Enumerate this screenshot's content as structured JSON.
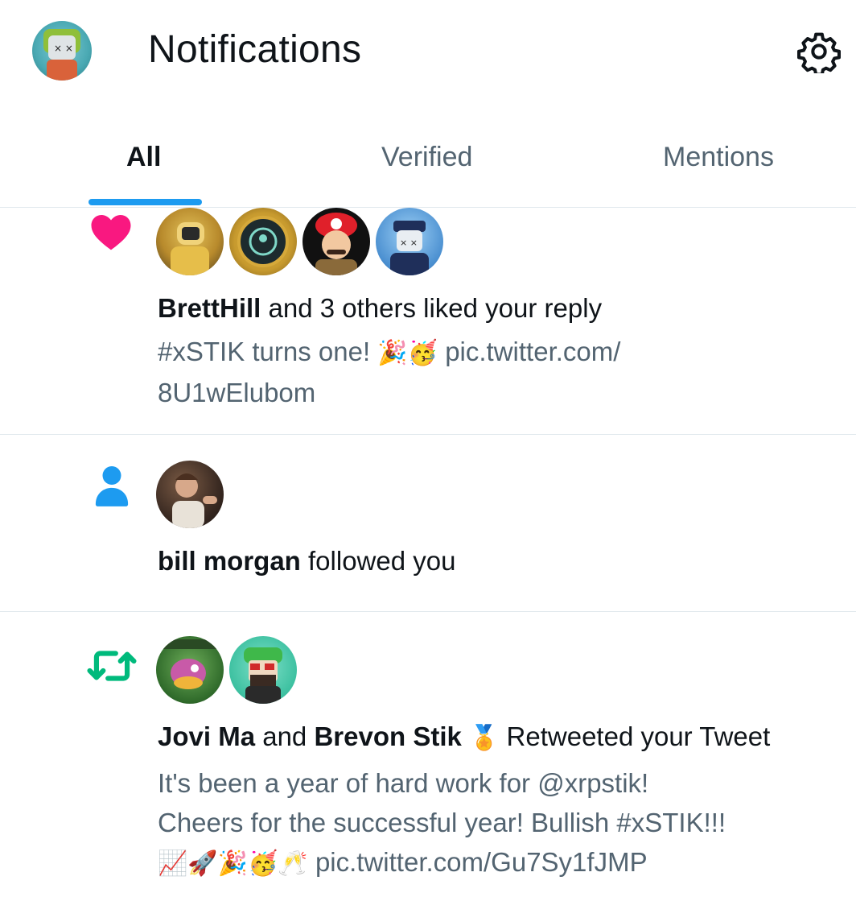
{
  "header": {
    "title": "Notifications",
    "profile_icon": "avatar-icon",
    "settings_icon": "gear-icon"
  },
  "tabs": [
    {
      "label": "All",
      "active": true
    },
    {
      "label": "Verified",
      "active": false
    },
    {
      "label": "Mentions",
      "active": false
    }
  ],
  "colors": {
    "accent": "#1d9bf0",
    "like": "#f91880",
    "retweet": "#00ba7c",
    "follow": "#1d9bf0",
    "secondary_text": "#536471"
  },
  "notifications": [
    {
      "type": "like",
      "icon": "heart-icon",
      "actor": "BrettHill",
      "action": " and 3 others liked your reply",
      "text_line1": "#xSTIK turns one! ",
      "text_link": " pic.twitter.com/",
      "text_line2": "8U1wElubom",
      "emojis": "🎉🥳",
      "avatar_count": 4
    },
    {
      "type": "follow",
      "icon": "person-icon",
      "actor": "bill morgan",
      "action": " followed you",
      "avatar_count": 1
    },
    {
      "type": "retweet",
      "icon": "retweet-icon",
      "actor1": "Jovi Ma",
      "connector": " and ",
      "actor2": "Brevon Stik",
      "badge_emoji": "🏅",
      "action": " Retweeted your Tweet",
      "text_line1": "It's been a year of hard work for @xrpstik!",
      "text_line2": "Cheers for the successful year! Bullish #xSTIK!!!",
      "text_line3_emojis": "📈🚀🎉🥳🥂",
      "text_line3_link": " pic.twitter.com/Gu7Sy1fJMP",
      "avatar_count": 2
    }
  ]
}
